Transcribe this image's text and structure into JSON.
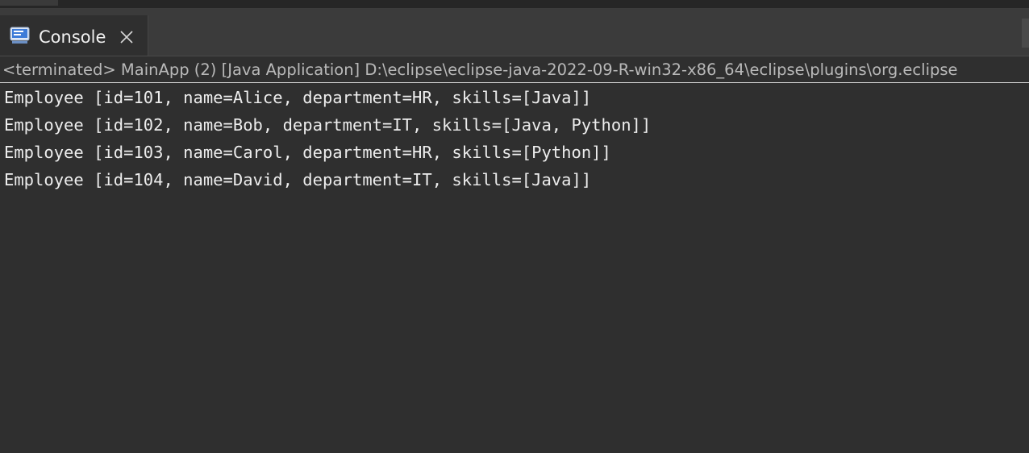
{
  "view": {
    "tab_label": "Console",
    "tab_icon": "console-icon",
    "close_icon": "close-icon"
  },
  "status": {
    "text": "<terminated> MainApp (2) [Java Application] D:\\eclipse\\eclipse-java-2022-09-R-win32-x86_64\\eclipse\\plugins\\org.eclipse"
  },
  "console": {
    "lines": [
      "Employee [id=101, name=Alice, department=HR, skills=[Java]]",
      "Employee [id=102, name=Bob, department=IT, skills=[Java, Python]]",
      "Employee [id=103, name=Carol, department=HR, skills=[Python]]",
      "Employee [id=104, name=David, department=IT, skills=[Java]]"
    ]
  },
  "colors": {
    "background": "#2f2f2f",
    "tabbar": "#3b3b3b",
    "text": "#ededed",
    "icon_blue": "#3d7bd8"
  }
}
